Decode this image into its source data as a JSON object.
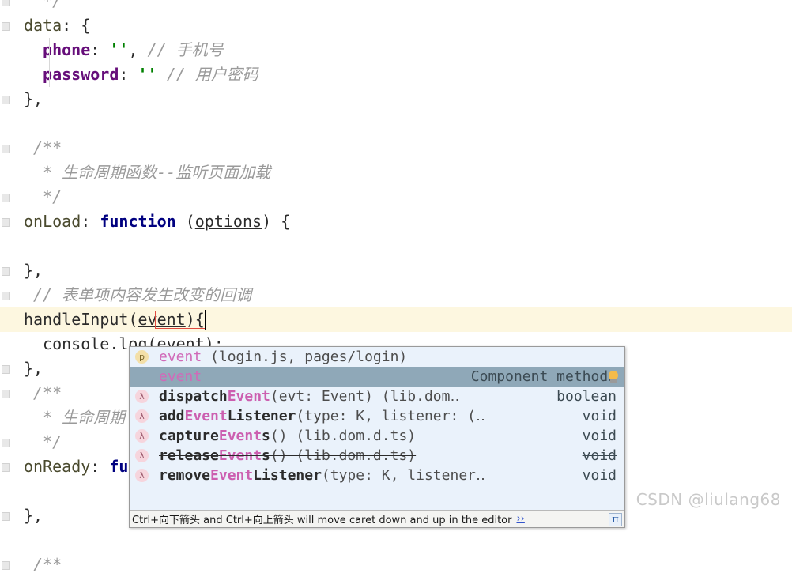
{
  "editor": {
    "current_line_index": 13,
    "caret_token": "event",
    "lines": [
      {
        "indent": 2,
        "tokens": [
          {
            "t": "comment",
            "s": "*/"
          }
        ]
      },
      {
        "indent": 0,
        "tokens": [
          {
            "t": "field",
            "s": "data"
          },
          {
            "t": "punct",
            "s": ": "
          },
          {
            "t": "punct",
            "s": "{"
          }
        ]
      },
      {
        "indent": 2,
        "tokens": [
          {
            "t": "prop",
            "s": "phone"
          },
          {
            "t": "punct",
            "s": ": "
          },
          {
            "t": "str",
            "s": "''"
          },
          {
            "t": "punct",
            "s": ", "
          },
          {
            "t": "comment",
            "s": "// 手机号"
          }
        ]
      },
      {
        "indent": 2,
        "tokens": [
          {
            "t": "prop",
            "s": "password"
          },
          {
            "t": "punct",
            "s": ": "
          },
          {
            "t": "str",
            "s": "''"
          },
          {
            "t": "punct",
            "s": " "
          },
          {
            "t": "comment",
            "s": "// 用户密码"
          }
        ]
      },
      {
        "indent": 0,
        "tokens": [
          {
            "t": "punct",
            "s": "},"
          }
        ]
      },
      {
        "indent": 0,
        "tokens": []
      },
      {
        "indent": 1,
        "tokens": [
          {
            "t": "comment",
            "s": "/**"
          }
        ]
      },
      {
        "indent": 1,
        "tokens": [
          {
            "t": "comment",
            "s": " * 生命周期函数--监听页面加载"
          }
        ]
      },
      {
        "indent": 1,
        "tokens": [
          {
            "t": "comment",
            "s": " */"
          }
        ]
      },
      {
        "indent": 0,
        "tokens": [
          {
            "t": "field",
            "s": "onLoad"
          },
          {
            "t": "punct",
            "s": ": "
          },
          {
            "t": "key",
            "s": "function"
          },
          {
            "t": "punct",
            "s": " ("
          },
          {
            "t": "param",
            "s": "options"
          },
          {
            "t": "punct",
            "s": ") {"
          }
        ]
      },
      {
        "indent": 0,
        "tokens": []
      },
      {
        "indent": 0,
        "tokens": [
          {
            "t": "punct",
            "s": "},"
          }
        ]
      },
      {
        "indent": 1,
        "tokens": [
          {
            "t": "comment",
            "s": "// 表单项内容发生改变的回调"
          }
        ]
      },
      {
        "indent": 0,
        "tokens": [
          {
            "t": "ident",
            "s": "handleInput"
          },
          {
            "t": "punct",
            "s": "("
          },
          {
            "t": "param",
            "s": "event"
          },
          {
            "t": "punct",
            "s": "){"
          }
        ]
      },
      {
        "indent": 2,
        "tokens": [
          {
            "t": "ident",
            "s": "console"
          },
          {
            "t": "punct",
            "s": "."
          },
          {
            "t": "ident",
            "s": "log"
          },
          {
            "t": "punct",
            "s": "("
          },
          {
            "t": "ident",
            "s": "event"
          },
          {
            "t": "punct",
            "s": ");"
          }
        ]
      },
      {
        "indent": 0,
        "tokens": [
          {
            "t": "punct",
            "s": "},"
          }
        ]
      },
      {
        "indent": 1,
        "tokens": [
          {
            "t": "comment",
            "s": "/**"
          }
        ]
      },
      {
        "indent": 1,
        "tokens": [
          {
            "t": "comment",
            "s": " * 生命周期"
          }
        ]
      },
      {
        "indent": 1,
        "tokens": [
          {
            "t": "comment",
            "s": " */"
          }
        ]
      },
      {
        "indent": 0,
        "tokens": [
          {
            "t": "field",
            "s": "onReady"
          },
          {
            "t": "punct",
            "s": ": "
          },
          {
            "t": "key",
            "s": "fu"
          }
        ]
      },
      {
        "indent": 0,
        "tokens": []
      },
      {
        "indent": 0,
        "tokens": [
          {
            "t": "punct",
            "s": "},"
          }
        ]
      },
      {
        "indent": 0,
        "tokens": []
      },
      {
        "indent": 1,
        "tokens": [
          {
            "t": "comment",
            "s": "/**"
          }
        ]
      }
    ]
  },
  "autocomplete": {
    "selected_index": 1,
    "items": [
      {
        "icon": "property-icon",
        "icon_glyph": "p",
        "icon_kind": "prop",
        "name": "event",
        "suffix": " (login.js, pages/login)",
        "right": "",
        "deprecated": false
      },
      {
        "icon": "none",
        "icon_glyph": "",
        "icon_kind": "blank",
        "name": "event",
        "suffix": "",
        "right": "Component methods",
        "deprecated": false
      },
      {
        "icon": "method-icon",
        "icon_glyph": "λ",
        "icon_kind": "method",
        "name_pre": "dispatch",
        "name_hl": "Event",
        "name_post": "",
        "suffix": "(evt: Event) (lib.dom‥",
        "right": "boolean",
        "deprecated": false
      },
      {
        "icon": "method-icon",
        "icon_glyph": "λ",
        "icon_kind": "method",
        "name_pre": "add",
        "name_hl": "Event",
        "name_post": "Listener",
        "suffix": "(type: K, listener: (‥",
        "right": "void",
        "deprecated": false
      },
      {
        "icon": "method-icon",
        "icon_glyph": "λ",
        "icon_kind": "method",
        "name_pre": "capture",
        "name_hl": "Event",
        "name_post": "s",
        "suffix": "() (lib.dom.d.ts)",
        "right": "void",
        "deprecated": true
      },
      {
        "icon": "method-icon",
        "icon_glyph": "λ",
        "icon_kind": "method",
        "name_pre": "release",
        "name_hl": "Event",
        "name_post": "s",
        "suffix": "() (lib.dom.d.ts)",
        "right": "void",
        "deprecated": true
      },
      {
        "icon": "method-icon",
        "icon_glyph": "λ",
        "icon_kind": "method",
        "name_pre": "remove",
        "name_hl": "Event",
        "name_post": "Listener",
        "suffix": "(type: K, listener‥",
        "right": "void",
        "deprecated": false
      }
    ],
    "hint": "Ctrl+向下箭头 and Ctrl+向上箭头 will move caret down and up in the editor",
    "hint_more": "››",
    "pi_badge": "π",
    "lightbulb": "lightbulb-icon"
  },
  "watermark": {
    "text": "CSDN @liulang68"
  },
  "colors": {
    "current_line_highlight": "#fdf7e0",
    "popup_background": "#eaf2fb",
    "selected_row": "#8fa8b8",
    "keyword": "#000080",
    "property": "#660e7a",
    "string": "#008000",
    "comment": "#9a9a9a",
    "match_highlight": "#cc5fb0",
    "caret_box": "#e04a3f"
  }
}
